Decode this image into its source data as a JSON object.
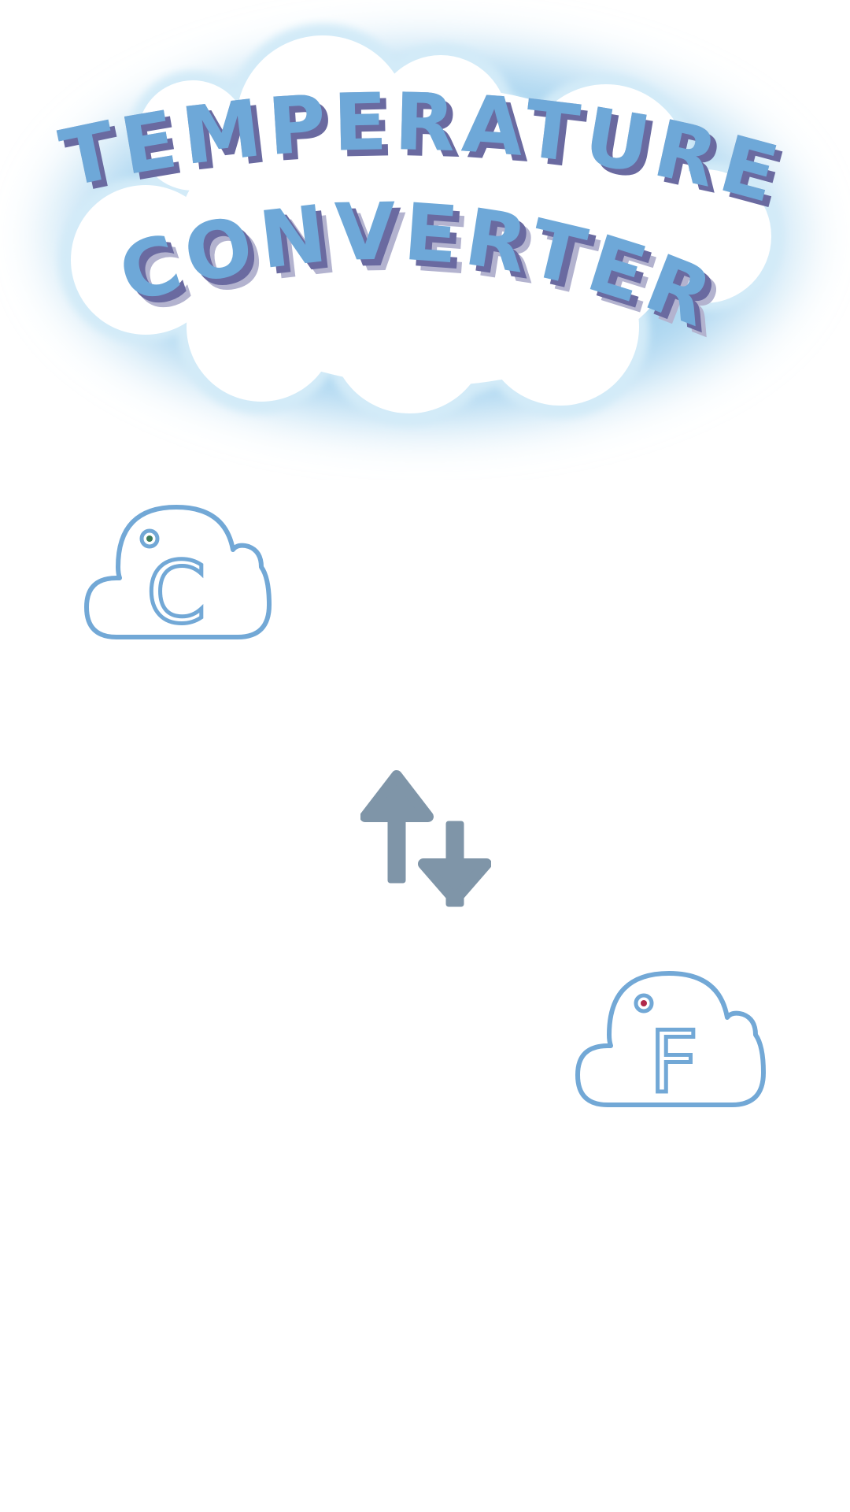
{
  "header": {
    "title_line1": "TEMPERATURE",
    "title_line2": "CONVERTER",
    "title_color": "#6ea8d8",
    "title_shadow_color": "#6a6aa0",
    "cloud_fill": "#ffffff",
    "cloud_glow_color": "#9fd0ee"
  },
  "units": {
    "celsius": {
      "letter": "C",
      "degree_dot_color": "#3d7a58",
      "icon": "celsius-cloud-icon"
    },
    "fahrenheit": {
      "letter": "F",
      "degree_dot_color": "#b0284a",
      "icon": "fahrenheit-cloud-icon"
    },
    "outline_color": "#72a8d6"
  },
  "swap": {
    "icon": "swap-arrows-icon",
    "color": "#7f95a8"
  }
}
